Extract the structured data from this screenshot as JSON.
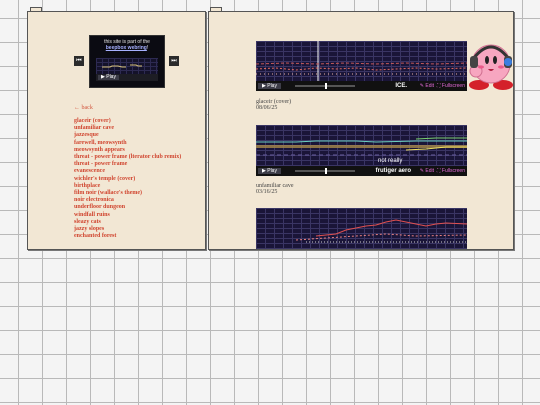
{
  "webring": {
    "line1": "this site is part of the",
    "link": "beepbox webring",
    "suffix": "!",
    "play": "▶ Play",
    "prev": "⏮",
    "next": "⏭"
  },
  "sidebar": {
    "back": "← back",
    "songs": [
      "glaceir (cover)",
      "unfamiliar cave",
      "jazzesque",
      "farewell, meowsynth",
      "meowsynth appears",
      "threat - power frame (lterator club remix)",
      "threat - power frame",
      "evanescence",
      "wichler's temple (cover)",
      "birthplace",
      "film noir (wallace's theme)",
      "noir electronica",
      "underfloor dungeon",
      "windfall ruins",
      "sleazy cats",
      "jazzy slopes",
      "enchanted forest"
    ]
  },
  "players": [
    {
      "song_title": "ICE.",
      "edit": "✎ Edit",
      "fullscreen": "⛶ Fullscreen",
      "play": "▶ Play",
      "caption_name": "glaceir (cover)",
      "caption_date": "08/06/25"
    },
    {
      "song_title": "frutiger aero",
      "overlay": "not really",
      "edit": "✎ Edit",
      "fullscreen": "⛶ Fullscreen",
      "play": "▶ Play",
      "caption_name": "unfamiliar cave",
      "caption_date": "03/16/25"
    }
  ],
  "colors": {
    "link": "#d0452f",
    "panel": "#f2e7d4",
    "accent": "#e46bd8"
  },
  "icons": {
    "mascot": "kirby-with-headphones-icon"
  }
}
